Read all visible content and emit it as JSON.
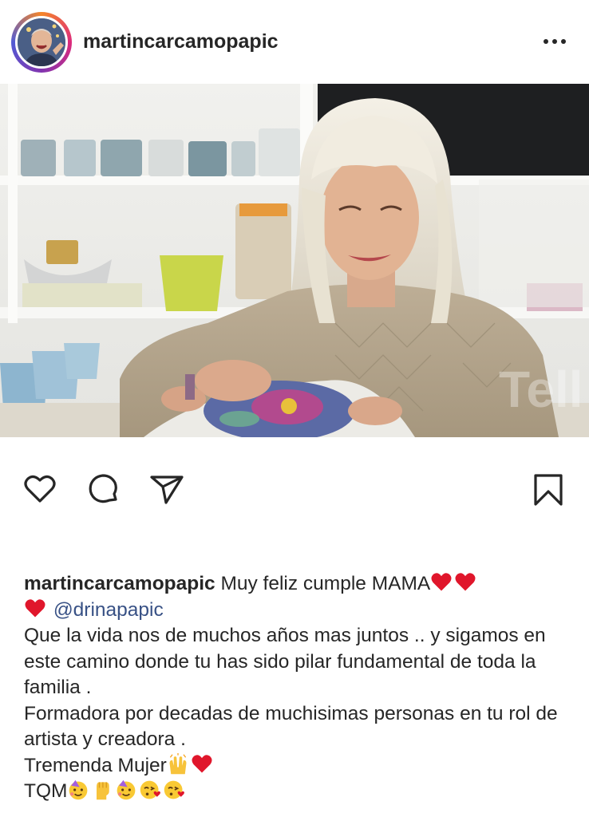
{
  "post": {
    "author": "martincarcamopapic",
    "more_icon": "more-horizontal-icon"
  },
  "photo": {
    "watermark": "Tell"
  },
  "actions": {
    "icons": [
      "heart-icon",
      "comment-icon",
      "share-icon",
      "bookmark-icon"
    ]
  },
  "caption": {
    "author": "martincarcamopapic",
    "line1_text": "Muy feliz cumple MAMA",
    "mention": "@drinapapic",
    "paragraph1": "Que la vida nos de muchos años mas juntos .. y sigamos en este camino  donde tu has sido pilar fundamental de toda la familia .",
    "paragraph2": "Formadora por decadas de muchisimas personas en tu rol de artista y creadora .",
    "line_tremenda": "Tremenda Mujer",
    "line_tqm": "TQM"
  },
  "colors": {
    "text": "#262626",
    "mention": "#385185",
    "heart_red": "#e0162b"
  }
}
